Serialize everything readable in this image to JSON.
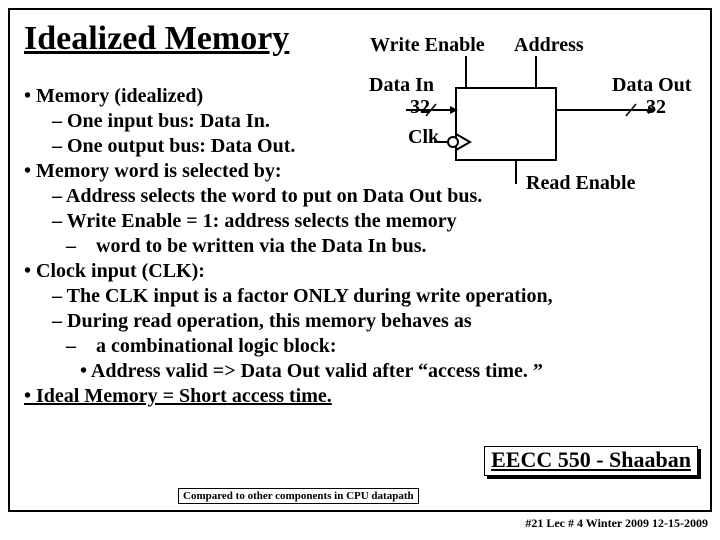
{
  "title": "Idealized Memory",
  "top": {
    "writeEnable": "Write Enable",
    "address": "Address"
  },
  "diagram": {
    "dataIn": "Data In",
    "dataOut": "Data Out",
    "busIn": "32",
    "busOut": "32",
    "clk": "Clk",
    "readEnable": "Read Enable"
  },
  "bullets": {
    "b1": "Memory (idealized)",
    "b1a": "One input bus:  Data In.",
    "b1b": "One output bus:  Data Out.",
    "b2": "Memory word is selected by:",
    "b2a": "Address selects the word to put on Data Out bus.",
    "b2b": "Write Enable = 1:  address selects the memory",
    "b2b_cont": "word to be written via the  Data In bus.",
    "b3": "Clock input (CLK):",
    "b3a": "The CLK input is a factor ONLY during write operation,",
    "b3b": "During read operation, this memory behaves  as",
    "b3b_cont": "a combinational logic block:",
    "b3c": "Address valid  => Data Out valid after “access time. ”",
    "b4": "Ideal Memory = Short access time."
  },
  "footer": {
    "compared": "Compared to other components in CPU datapath",
    "course": "EECC 550 - Shaaban",
    "page": "#21   Lec # 4   Winter 2009  12-15-2009"
  }
}
